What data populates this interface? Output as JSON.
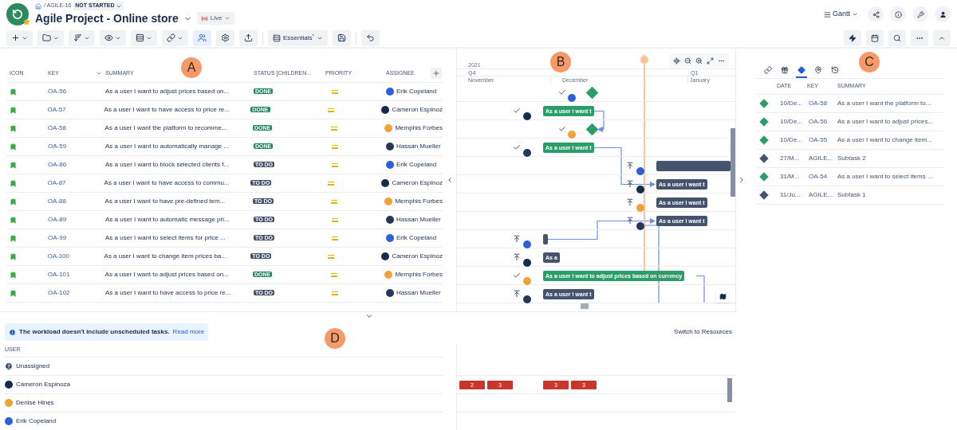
{
  "breadcrumb": {
    "key": "/ AGILE-16",
    "status": "NOT STARTED"
  },
  "title": "Agile Project - Online store",
  "live": "Live",
  "view": "Gantt",
  "tools": [
    {
      "kind": "add",
      "selected": false
    },
    {
      "kind": "folder",
      "selected": false
    },
    {
      "kind": "sort",
      "selected": false
    },
    {
      "kind": "eye",
      "selected": false
    },
    {
      "kind": "rows",
      "selected": false
    },
    {
      "kind": "link",
      "selected": false
    },
    {
      "kind": "people",
      "selected": true
    },
    {
      "kind": "settings",
      "selected": false
    },
    {
      "kind": "export",
      "selected": false
    }
  ],
  "preset": "Essentials$^{*}$",
  "table": {
    "columns": [
      "ICON",
      "KEY",
      "SUMMARY",
      "STATUS [CHILDREN...",
      "PRIORITY",
      "ASSIGNEE"
    ],
    "rows": [
      {
        "key": "OA-56",
        "summary": "As a user I want to adjust prices based on...",
        "status": {
          "label": "DONE",
          "color": "#1f845a"
        },
        "assignee": {
          "name": "Erik Copeland",
          "color": "#2d5fd6"
        }
      },
      {
        "key": "OA-57",
        "summary": "As a user I want to have access to price re...",
        "status": {
          "label": "DONE",
          "color": "#1f845a"
        },
        "assignee": {
          "name": "Cameron Espinoz",
          "color": "#172b4d"
        }
      },
      {
        "key": "OA-58",
        "summary": "As a user I want the platform to recomme...",
        "status": {
          "label": "DONE",
          "color": "#1f845a"
        },
        "assignee": {
          "name": "Memphis Forbes",
          "color": "#f0a13a"
        }
      },
      {
        "key": "OA-59",
        "summary": "As a user I want to automatically manage ...",
        "status": {
          "label": "DONE",
          "color": "#1f845a"
        },
        "assignee": {
          "name": "Hassan Mueller",
          "color": "#253858"
        }
      },
      {
        "key": "OA-86",
        "summary": "As a user I want to block selected clients f...",
        "status": {
          "label": "TO DO",
          "color": "#44546f"
        },
        "assignee": {
          "name": "Erik Copeland",
          "color": "#2d5fd6"
        }
      },
      {
        "key": "OA-87",
        "summary": "As a user I want to have access to commu...",
        "status": {
          "label": "TO DO",
          "color": "#44546f"
        },
        "assignee": {
          "name": "Cameron Espinoz",
          "color": "#172b4d"
        }
      },
      {
        "key": "OA-88",
        "summary": "As a user I want to have pre-defined tem...",
        "status": {
          "label": "TO DO",
          "color": "#44546f"
        },
        "assignee": {
          "name": "Memphis Forbes",
          "color": "#f0a13a"
        }
      },
      {
        "key": "OA-89",
        "summary": "As a user I want to automatic message pri...",
        "status": {
          "label": "TO DO",
          "color": "#44546f"
        },
        "assignee": {
          "name": "Hassan Mueller",
          "color": "#253858"
        }
      },
      {
        "key": "OA-99",
        "summary": "As a user I want to select items for price ...",
        "status": {
          "label": "TO DO",
          "color": "#44546f"
        },
        "assignee": {
          "name": "Erik Copeland",
          "color": "#2d5fd6"
        }
      },
      {
        "key": "OA-100",
        "summary": "As a user I want to change item prices ba...",
        "status": {
          "label": "TO DO",
          "color": "#44546f"
        },
        "assignee": {
          "name": "Cameron Espinoz",
          "color": "#172b4d"
        }
      },
      {
        "key": "OA-101",
        "summary": "As a user I want to adjust prices based on...",
        "status": {
          "label": "DONE",
          "color": "#1f845a"
        },
        "assignee": {
          "name": "Memphis Forbes",
          "color": "#f0a13a"
        }
      },
      {
        "key": "OA-102",
        "summary": "As a user I want to have access to price re...",
        "status": {
          "label": "TO DO",
          "color": "#44546f"
        },
        "assignee": {
          "name": "Hassan Mueller",
          "color": "#253858"
        }
      }
    ]
  },
  "gantt": {
    "year": "2021",
    "quarters": [
      "Q4",
      "Q1"
    ],
    "months": [
      "November",
      "December",
      "January"
    ],
    "rows": [
      {
        "done": true,
        "avatar": {
          "color": "#2d5fd6"
        },
        "bar": {
          "kind": "milestone",
          "color": "#2a9d68"
        }
      },
      {
        "done": true,
        "avatar": {
          "color": "#172b4d"
        },
        "bar": {
          "kind": "bar",
          "color": "#2a9d68",
          "label": "As a user I want t"
        }
      },
      {
        "done": true,
        "avatar": {
          "color": "#f0a13a"
        },
        "bar": {
          "kind": "milestone",
          "color": "#2a9d68"
        }
      },
      {
        "done": true,
        "avatar": {
          "color": "#253858"
        },
        "bar": {
          "kind": "bar",
          "color": "#2a9d68",
          "label": "As a user I want t"
        }
      },
      {
        "done": false,
        "avatar": {
          "color": "#2d5fd6"
        },
        "bar": {
          "kind": "bar",
          "color": "#44546f"
        }
      },
      {
        "done": false,
        "avatar": {
          "color": "#172b4d"
        },
        "bar": {
          "kind": "bar",
          "color": "#44546f",
          "label": "As a user I want t"
        }
      },
      {
        "done": false,
        "avatar": {
          "color": "#f0a13a"
        },
        "bar": {
          "kind": "bar",
          "color": "#44546f",
          "label": "As a user I want t"
        }
      },
      {
        "done": false,
        "avatar": {
          "color": "#253858"
        },
        "bar": {
          "kind": "bar",
          "color": "#44546f",
          "label": "As a user I want t"
        }
      },
      {
        "done": false,
        "avatar": {
          "color": "#2d5fd6"
        },
        "bar": {
          "kind": "bar",
          "color": "#44546f"
        }
      },
      {
        "done": false,
        "avatar": {
          "color": "#172b4d"
        },
        "bar": {
          "kind": "bar",
          "color": "#44546f",
          "label": "As a"
        }
      },
      {
        "done": true,
        "avatar": {
          "color": "#f0a13a"
        },
        "bar": {
          "kind": "bar",
          "color": "#2a9d68",
          "label": "As a user I want to adjust prices based on currency"
        }
      },
      {
        "done": false,
        "avatar": {
          "color": "#253858"
        },
        "bar": {
          "kind": "bar",
          "color": "#44546f",
          "label": "As a user I want t"
        }
      }
    ]
  },
  "panel": {
    "tabs": [
      {
        "kind": "link",
        "selected": false
      },
      {
        "kind": "gift",
        "selected": false
      },
      {
        "kind": "milestone",
        "selected": true
      },
      {
        "kind": "pin",
        "selected": false
      },
      {
        "kind": "history",
        "selected": false
      }
    ],
    "columns": [
      "DATE",
      "KEY",
      "SUMMARY"
    ],
    "rows": [
      {
        "date": "10/De...",
        "key": "OA-58",
        "link": true,
        "summary": "As a user I want the platform to...",
        "color": "#2a9d68"
      },
      {
        "date": "10/De...",
        "key": "OA-56",
        "link": true,
        "summary": "As a user I want to adjust prices...",
        "color": "#2a9d68"
      },
      {
        "date": "10/De...",
        "key": "OA-55",
        "link": true,
        "summary": "As a user I want to change item...",
        "color": "#2a9d68"
      },
      {
        "date": "27/M...",
        "key": "AGILE...",
        "link": false,
        "summary": "Subtask 2",
        "color": "#44546f"
      },
      {
        "date": "31/M...",
        "key": "OA-54",
        "link": true,
        "summary": "As a user I want to select items ...",
        "color": "#2a9d68"
      },
      {
        "date": "11/Ju...",
        "key": "AGILE...",
        "link": false,
        "summary": "Subtask 1",
        "color": "#44546f"
      }
    ]
  },
  "workload": {
    "notice": "The workload doesn't include unscheduled tasks.",
    "link": "Read more",
    "switch": "Switch to Resources",
    "column": "USER",
    "users": [
      {
        "name": "Unassigned"
      },
      {
        "name": "Cameron Espinoza",
        "color": "#172b4d",
        "load_groups": [
          [
            "2",
            "3"
          ],
          [
            "3",
            "3"
          ]
        ]
      },
      {
        "name": "Denise Hines",
        "color": "#f0a13a"
      },
      {
        "name": "Erik Copeland",
        "color": "#2d5fd6"
      }
    ]
  },
  "callouts": [
    "A",
    "B",
    "C",
    "D"
  ]
}
